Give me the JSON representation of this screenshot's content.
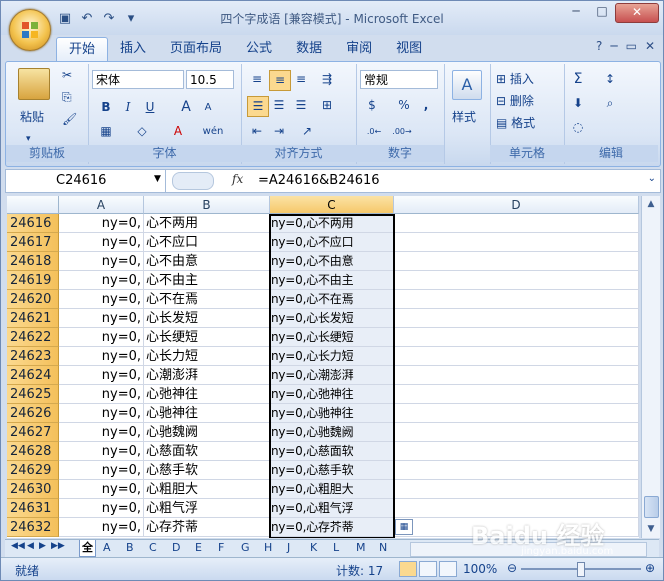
{
  "window": {
    "title": "四个字成语 [兼容模式] - Microsoft Excel",
    "qat": {
      "save_icon": "save-icon",
      "undo_icon": "undo-icon",
      "redo_icon": "redo-icon"
    }
  },
  "ribbon_tabs": [
    "开始",
    "插入",
    "页面布局",
    "公式",
    "数据",
    "审阅",
    "视图"
  ],
  "ribbon": {
    "clipboard": {
      "paste_label": "粘贴",
      "group_label": "剪贴板"
    },
    "font": {
      "font_name": "宋体",
      "font_size": "10.5",
      "bold": "B",
      "italic": "I",
      "underline": "U",
      "group_label": "字体",
      "grow": "A",
      "shrink": "A",
      "color_a": "A",
      "wen": "wén"
    },
    "alignment": {
      "group_label": "对齐方式"
    },
    "number": {
      "format": "常规",
      "group_label": "数字",
      "percent": "%",
      "comma": ",",
      "inc_dec": ".0→.00",
      "dec_dec": ".00→.0"
    },
    "styles": {
      "label": "样式"
    },
    "cells": {
      "insert": "插入",
      "delete": "删除",
      "format": "格式",
      "group_label": "单元格"
    },
    "editing": {
      "group_label": "编辑",
      "sum": "Σ"
    }
  },
  "formula_bar": {
    "name_box": "C24616",
    "fx": "fx",
    "formula": "=A24616&B24616"
  },
  "columns": [
    "A",
    "B",
    "C",
    "D"
  ],
  "rows": [
    {
      "num": "24616",
      "a": "ny=0,",
      "b": "心不两用",
      "c": "ny=0,心不两用"
    },
    {
      "num": "24617",
      "a": "ny=0,",
      "b": "心不应口",
      "c": "ny=0,心不应口"
    },
    {
      "num": "24618",
      "a": "ny=0,",
      "b": "心不由意",
      "c": "ny=0,心不由意"
    },
    {
      "num": "24619",
      "a": "ny=0,",
      "b": "心不由主",
      "c": "ny=0,心不由主"
    },
    {
      "num": "24620",
      "a": "ny=0,",
      "b": "心不在焉",
      "c": "ny=0,心不在焉"
    },
    {
      "num": "24621",
      "a": "ny=0,",
      "b": "心长发短",
      "c": "ny=0,心长发短"
    },
    {
      "num": "24622",
      "a": "ny=0,",
      "b": "心长绠短",
      "c": "ny=0,心长绠短"
    },
    {
      "num": "24623",
      "a": "ny=0,",
      "b": "心长力短",
      "c": "ny=0,心长力短"
    },
    {
      "num": "24624",
      "a": "ny=0,",
      "b": "心潮澎湃",
      "c": "ny=0,心潮澎湃"
    },
    {
      "num": "24625",
      "a": "ny=0,",
      "b": "心弛神往",
      "c": "ny=0,心弛神往"
    },
    {
      "num": "24626",
      "a": "ny=0,",
      "b": "心驰神往",
      "c": "ny=0,心驰神往"
    },
    {
      "num": "24627",
      "a": "ny=0,",
      "b": "心驰魏阙",
      "c": "ny=0,心驰魏阙"
    },
    {
      "num": "24628",
      "a": "ny=0,",
      "b": "心慈面软",
      "c": "ny=0,心慈面软"
    },
    {
      "num": "24629",
      "a": "ny=0,",
      "b": "心慈手软",
      "c": "ny=0,心慈手软"
    },
    {
      "num": "24630",
      "a": "ny=0,",
      "b": "心粗胆大",
      "c": "ny=0,心粗胆大"
    },
    {
      "num": "24631",
      "a": "ny=0,",
      "b": "心粗气浮",
      "c": "ny=0,心粗气浮"
    },
    {
      "num": "24632",
      "a": "ny=0,",
      "b": "心存芥蒂",
      "c": "ny=0,心存芥蒂"
    }
  ],
  "sheet_tabs": [
    "全",
    "A",
    "B",
    "C",
    "D",
    "E",
    "F",
    "G",
    "H",
    "J",
    "K",
    "L",
    "M",
    "N"
  ],
  "status": {
    "ready": "就绪",
    "count": "计数: 17",
    "zoom": "100%"
  },
  "watermark": {
    "main": "Baidu 经验",
    "sub": "jingyan.baidu.com"
  }
}
